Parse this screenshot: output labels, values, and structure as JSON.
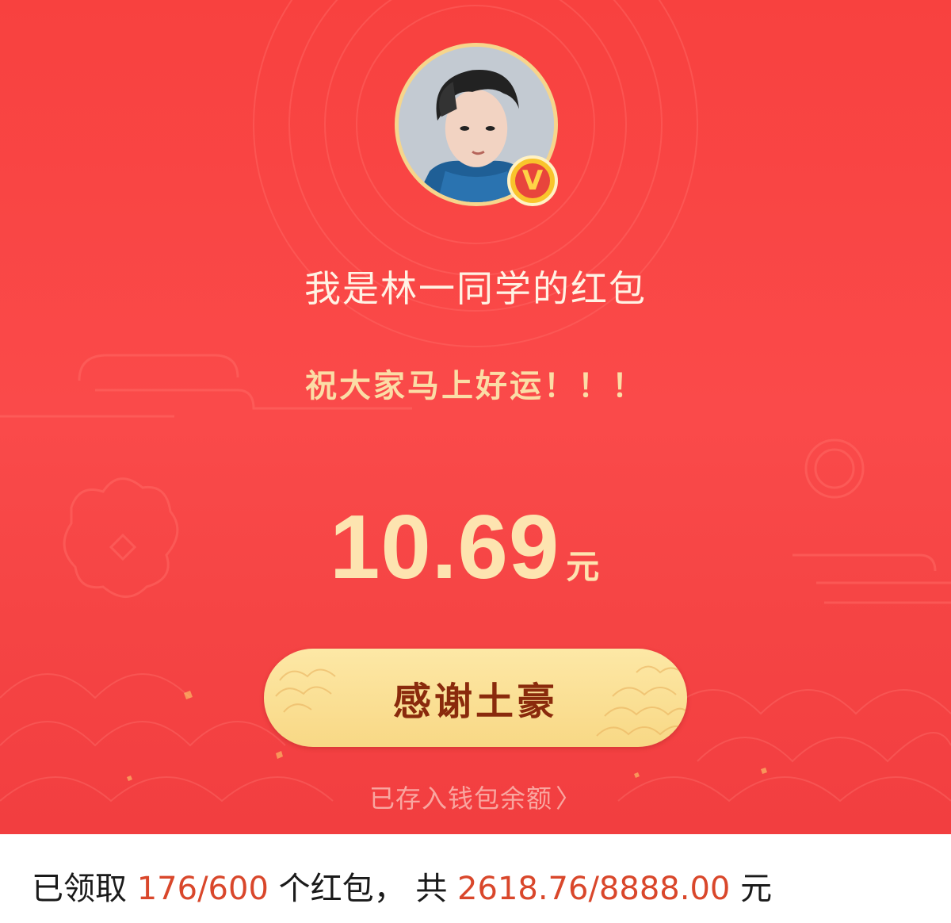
{
  "red_packet": {
    "sender_title": "我是林一同学的红包",
    "greeting": "祝大家马上好运！！！",
    "amount": {
      "value": "10.69",
      "unit": "元"
    },
    "thanks_button_label": "感谢土豪",
    "wallet_link_label": "已存入钱包余额",
    "wallet_link_icon": "chevron-right-icon",
    "verified_badge_letter": "V"
  },
  "summary": {
    "prefix": "已领取",
    "claimed_count": "176/600",
    "middle": "个红包，  共",
    "claimed_amount": "2618.76/8888.00",
    "suffix": "元"
  },
  "colors": {
    "panel_red": "#f8413f",
    "gold_text": "#fde4b0",
    "button_gold": "#fde8a6",
    "button_text": "#8a2a0c",
    "highlight": "#d9472b"
  }
}
